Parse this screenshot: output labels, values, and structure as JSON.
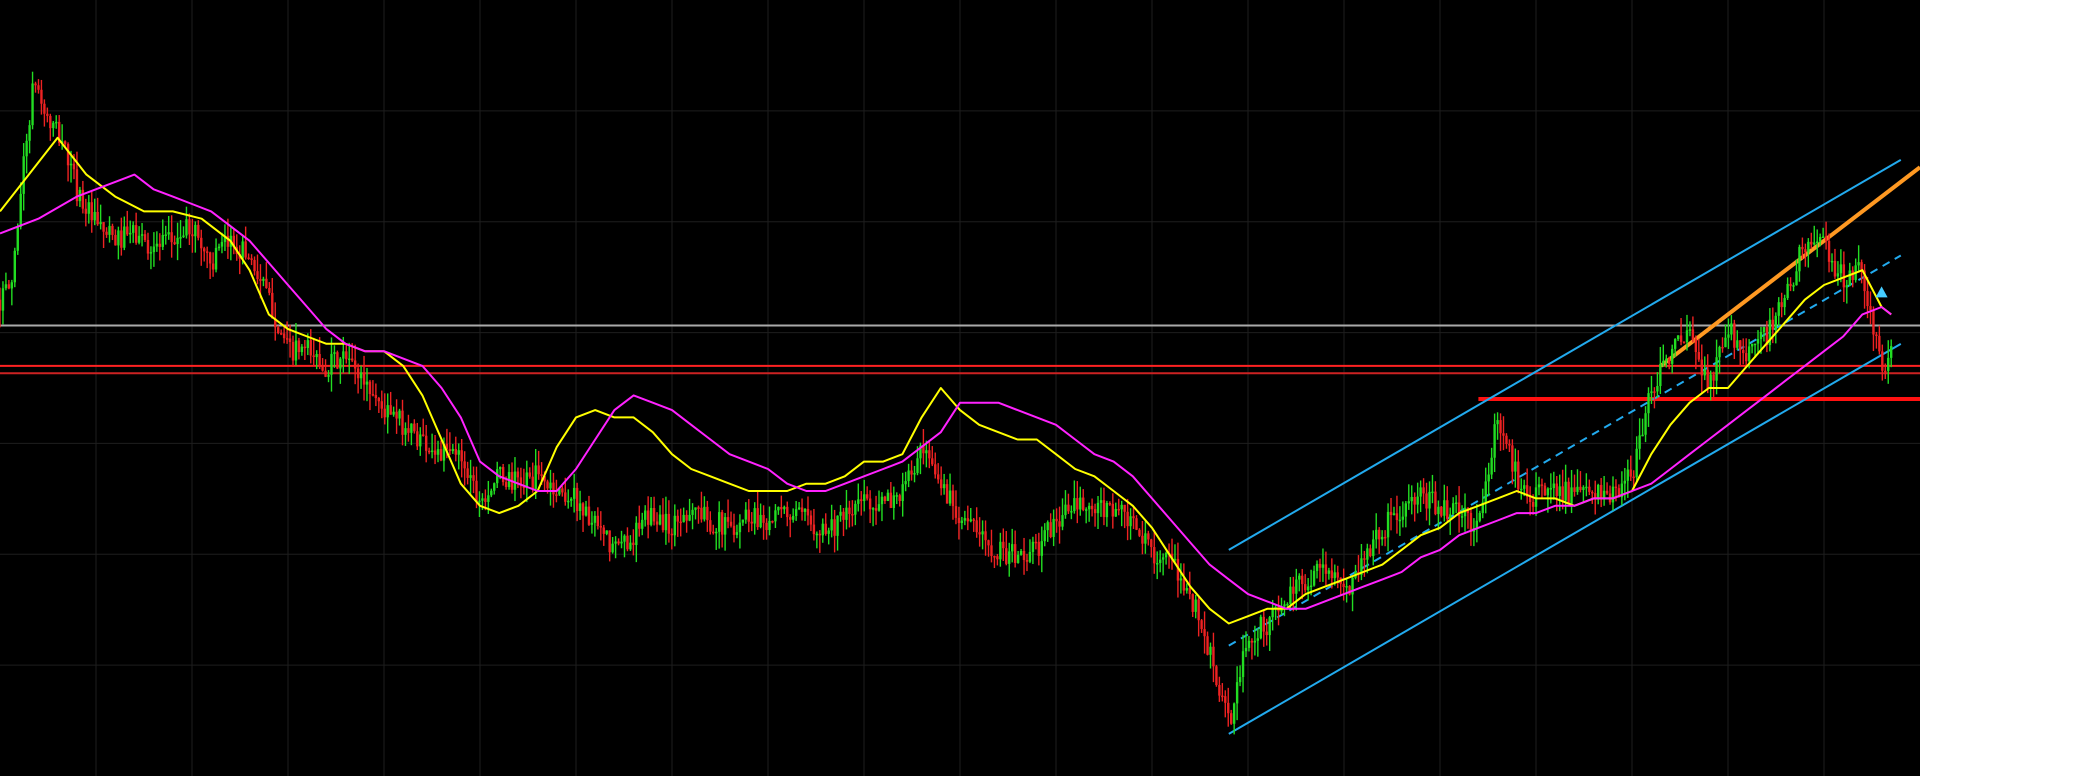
{
  "chart_data": {
    "type": "candlestick",
    "title": "",
    "xlabel": "",
    "ylabel": "",
    "background_color": "#000000",
    "grid": true,
    "grid_color": "#1e1e1e",
    "x_range": [
      0,
      100
    ],
    "y_range": [
      0,
      100
    ],
    "up_color": "#22dd22",
    "down_color": "#ee2222",
    "price_path": [
      [
        0,
        62
      ],
      [
        0.6,
        64
      ],
      [
        1.2,
        80
      ],
      [
        1.8,
        92
      ],
      [
        2.5,
        86
      ],
      [
        3.2,
        84
      ],
      [
        4,
        77
      ],
      [
        5,
        72
      ],
      [
        6,
        70
      ],
      [
        7,
        71
      ],
      [
        8,
        69
      ],
      [
        9,
        70
      ],
      [
        10,
        72
      ],
      [
        11,
        67
      ],
      [
        12,
        70
      ],
      [
        13,
        68
      ],
      [
        14,
        62
      ],
      [
        15,
        55
      ],
      [
        16,
        55
      ],
      [
        17,
        53
      ],
      [
        18,
        54
      ],
      [
        19,
        51
      ],
      [
        20,
        47
      ],
      [
        21,
        45
      ],
      [
        22,
        43
      ],
      [
        23,
        41
      ],
      [
        24,
        41
      ],
      [
        25,
        35
      ],
      [
        26,
        38
      ],
      [
        27,
        37
      ],
      [
        28,
        38
      ],
      [
        29,
        36
      ],
      [
        30,
        35
      ],
      [
        31,
        31
      ],
      [
        32,
        28
      ],
      [
        33,
        30
      ],
      [
        34,
        33
      ],
      [
        35,
        31
      ],
      [
        36,
        34
      ],
      [
        37,
        32
      ],
      [
        38,
        31
      ],
      [
        39,
        33
      ],
      [
        40,
        32
      ],
      [
        41,
        33
      ],
      [
        42,
        32
      ],
      [
        43,
        31
      ],
      [
        44,
        32
      ],
      [
        45,
        35
      ],
      [
        46,
        34
      ],
      [
        47,
        36
      ],
      [
        48,
        41
      ],
      [
        49,
        37
      ],
      [
        50,
        33
      ],
      [
        51,
        30
      ],
      [
        52,
        28
      ],
      [
        53,
        27
      ],
      [
        54,
        28
      ],
      [
        55,
        32
      ],
      [
        56,
        34
      ],
      [
        57,
        33
      ],
      [
        58,
        34
      ],
      [
        59,
        31
      ],
      [
        60,
        28
      ],
      [
        61,
        26
      ],
      [
        62,
        22
      ],
      [
        63,
        14
      ],
      [
        64,
        4
      ],
      [
        65,
        16
      ],
      [
        66,
        18
      ],
      [
        67,
        21
      ],
      [
        68,
        24
      ],
      [
        69,
        26
      ],
      [
        70,
        22
      ],
      [
        71,
        27
      ],
      [
        72,
        31
      ],
      [
        73,
        33
      ],
      [
        74,
        35
      ],
      [
        75,
        34
      ],
      [
        76,
        33
      ],
      [
        77,
        31
      ],
      [
        78,
        46
      ],
      [
        79,
        38
      ],
      [
        80,
        35
      ],
      [
        81,
        37
      ],
      [
        82,
        35
      ],
      [
        83,
        36
      ],
      [
        84,
        35
      ],
      [
        85,
        38
      ],
      [
        86,
        50
      ],
      [
        87,
        55
      ],
      [
        88,
        57
      ],
      [
        89,
        50
      ],
      [
        90,
        58
      ],
      [
        91,
        55
      ],
      [
        92,
        57
      ],
      [
        93,
        62
      ],
      [
        94,
        70
      ],
      [
        95,
        69
      ],
      [
        96,
        65
      ],
      [
        97,
        66
      ],
      [
        98,
        52
      ],
      [
        98.5,
        55
      ]
    ],
    "moving_averages": [
      {
        "color": "#ffff00",
        "values": [
          [
            0,
            74
          ],
          [
            1.5,
            79
          ],
          [
            3,
            84
          ],
          [
            4.5,
            79
          ],
          [
            6,
            76
          ],
          [
            7.5,
            74
          ],
          [
            9,
            74
          ],
          [
            10.5,
            73
          ],
          [
            12,
            70
          ],
          [
            13,
            66
          ],
          [
            14,
            60
          ],
          [
            15,
            58
          ],
          [
            16,
            57
          ],
          [
            17,
            56
          ],
          [
            18,
            56
          ],
          [
            19,
            55
          ],
          [
            20,
            55
          ],
          [
            21,
            53
          ],
          [
            22,
            49
          ],
          [
            23,
            43
          ],
          [
            24,
            37
          ],
          [
            25,
            34
          ],
          [
            26,
            33
          ],
          [
            27,
            34
          ],
          [
            28,
            36
          ],
          [
            29,
            42
          ],
          [
            30,
            46
          ],
          [
            31,
            47
          ],
          [
            32,
            46
          ],
          [
            33,
            46
          ],
          [
            34,
            44
          ],
          [
            35,
            41
          ],
          [
            36,
            39
          ],
          [
            37,
            38
          ],
          [
            38,
            37
          ],
          [
            39,
            36
          ],
          [
            40,
            36
          ],
          [
            41,
            36
          ],
          [
            42,
            37
          ],
          [
            43,
            37
          ],
          [
            44,
            38
          ],
          [
            45,
            40
          ],
          [
            46,
            40
          ],
          [
            47,
            41
          ],
          [
            48,
            46
          ],
          [
            49,
            50
          ],
          [
            50,
            47
          ],
          [
            51,
            45
          ],
          [
            52,
            44
          ],
          [
            53,
            43
          ],
          [
            54,
            43
          ],
          [
            55,
            41
          ],
          [
            56,
            39
          ],
          [
            57,
            38
          ],
          [
            58,
            36
          ],
          [
            59,
            34
          ],
          [
            60,
            31
          ],
          [
            61,
            27
          ],
          [
            62,
            23
          ],
          [
            63,
            20
          ],
          [
            64,
            18
          ],
          [
            65,
            19
          ],
          [
            66,
            20
          ],
          [
            67,
            20
          ],
          [
            68,
            22
          ],
          [
            69,
            23
          ],
          [
            70,
            24
          ],
          [
            71,
            25
          ],
          [
            72,
            26
          ],
          [
            73,
            28
          ],
          [
            74,
            30
          ],
          [
            75,
            31
          ],
          [
            76,
            33
          ],
          [
            77,
            34
          ],
          [
            78,
            35
          ],
          [
            79,
            36
          ],
          [
            80,
            35
          ],
          [
            81,
            35
          ],
          [
            82,
            34
          ],
          [
            83,
            35
          ],
          [
            84,
            35
          ],
          [
            85,
            36
          ],
          [
            86,
            41
          ],
          [
            87,
            45
          ],
          [
            88,
            48
          ],
          [
            89,
            50
          ],
          [
            90,
            50
          ],
          [
            91,
            53
          ],
          [
            92,
            56
          ],
          [
            93,
            59
          ],
          [
            94,
            62
          ],
          [
            95,
            64
          ],
          [
            96,
            65
          ],
          [
            97,
            66
          ],
          [
            98,
            61
          ],
          [
            98.5,
            60
          ]
        ]
      },
      {
        "color": "#ff22ff",
        "values": [
          [
            0,
            71
          ],
          [
            2,
            73
          ],
          [
            4,
            76
          ],
          [
            6,
            78
          ],
          [
            7,
            79
          ],
          [
            8,
            77
          ],
          [
            9,
            76
          ],
          [
            10,
            75
          ],
          [
            11,
            74
          ],
          [
            12,
            72
          ],
          [
            13,
            70
          ],
          [
            14,
            67
          ],
          [
            15,
            64
          ],
          [
            16,
            61
          ],
          [
            17,
            58
          ],
          [
            18,
            56
          ],
          [
            19,
            55
          ],
          [
            20,
            55
          ],
          [
            21,
            54
          ],
          [
            22,
            53
          ],
          [
            23,
            50
          ],
          [
            24,
            46
          ],
          [
            25,
            40
          ],
          [
            26,
            38
          ],
          [
            27,
            37
          ],
          [
            28,
            36
          ],
          [
            29,
            36
          ],
          [
            30,
            39
          ],
          [
            31,
            43
          ],
          [
            32,
            47
          ],
          [
            33,
            49
          ],
          [
            34,
            48
          ],
          [
            35,
            47
          ],
          [
            36,
            45
          ],
          [
            37,
            43
          ],
          [
            38,
            41
          ],
          [
            39,
            40
          ],
          [
            40,
            39
          ],
          [
            41,
            37
          ],
          [
            42,
            36
          ],
          [
            43,
            36
          ],
          [
            44,
            37
          ],
          [
            45,
            38
          ],
          [
            46,
            39
          ],
          [
            47,
            40
          ],
          [
            48,
            42
          ],
          [
            49,
            44
          ],
          [
            50,
            48
          ],
          [
            51,
            48
          ],
          [
            52,
            48
          ],
          [
            53,
            47
          ],
          [
            54,
            46
          ],
          [
            55,
            45
          ],
          [
            56,
            43
          ],
          [
            57,
            41
          ],
          [
            58,
            40
          ],
          [
            59,
            38
          ],
          [
            60,
            35
          ],
          [
            61,
            32
          ],
          [
            62,
            29
          ],
          [
            63,
            26
          ],
          [
            64,
            24
          ],
          [
            65,
            22
          ],
          [
            66,
            21
          ],
          [
            67,
            20
          ],
          [
            68,
            20
          ],
          [
            69,
            21
          ],
          [
            70,
            22
          ],
          [
            71,
            23
          ],
          [
            72,
            24
          ],
          [
            73,
            25
          ],
          [
            74,
            27
          ],
          [
            75,
            28
          ],
          [
            76,
            30
          ],
          [
            77,
            31
          ],
          [
            78,
            32
          ],
          [
            79,
            33
          ],
          [
            80,
            33
          ],
          [
            81,
            34
          ],
          [
            82,
            34
          ],
          [
            83,
            35
          ],
          [
            84,
            35
          ],
          [
            85,
            36
          ],
          [
            86,
            37
          ],
          [
            87,
            39
          ],
          [
            88,
            41
          ],
          [
            89,
            43
          ],
          [
            90,
            45
          ],
          [
            91,
            47
          ],
          [
            92,
            49
          ],
          [
            93,
            51
          ],
          [
            94,
            53
          ],
          [
            95,
            55
          ],
          [
            96,
            57
          ],
          [
            97,
            60
          ],
          [
            98,
            61
          ],
          [
            98.5,
            60
          ]
        ]
      }
    ],
    "horizontal_lines": [
      {
        "y": 58.5,
        "color": "#aaaaaa",
        "from": 0,
        "to": 100
      },
      {
        "y": 53,
        "color": "#ff2222",
        "from": 0,
        "to": 100
      },
      {
        "y": 52,
        "color": "#cc2222",
        "from": 0,
        "to": 100
      },
      {
        "y": 48.5,
        "color": "#ff1111",
        "from": 77,
        "to": 100
      }
    ],
    "trend_lines": [
      {
        "color": "#22aaee",
        "style": "solid",
        "from": [
          64,
          28
        ],
        "to": [
          99,
          81
        ]
      },
      {
        "color": "#22aaee",
        "style": "solid",
        "from": [
          64,
          3
        ],
        "to": [
          99,
          56
        ]
      },
      {
        "color": "#22aaee",
        "style": "dashed",
        "from": [
          64,
          15
        ],
        "to": [
          99,
          68
        ]
      },
      {
        "color": "#ff9922",
        "style": "solid",
        "from": [
          86.5,
          53
        ],
        "to": [
          100,
          80
        ]
      }
    ],
    "markers": [
      {
        "shape": "triangle-up",
        "color": "#44ccff",
        "x": 98,
        "y": 63
      }
    ]
  }
}
